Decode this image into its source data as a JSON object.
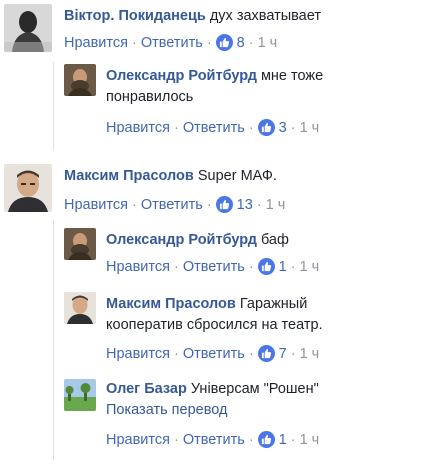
{
  "comments": [
    {
      "author": "Віктор. Покиданець",
      "text": "дух захватывает",
      "like": "Нравится",
      "reply": "Ответить",
      "likes": "8",
      "time": "1 ч"
    },
    {
      "author": "Олександр Ройтбурд",
      "text_line1": "мне тоже",
      "text_line2": "понравилось",
      "like": "Нравится",
      "reply": "Ответить",
      "likes": "3",
      "time": "1 ч"
    },
    {
      "author": "Максим Прасолов",
      "text": "Super МАФ.",
      "like": "Нравится",
      "reply": "Ответить",
      "likes": "13",
      "time": "1 ч"
    },
    {
      "author": "Олександр Ройтбурд",
      "text": "баф",
      "like": "Нравится",
      "reply": "Ответить",
      "likes": "1",
      "time": "1 ч"
    },
    {
      "author": "Максим Прасолов",
      "text_line1": "Гаражный",
      "text_line2": "кооператив сбросился на театр.",
      "like": "Нравится",
      "reply": "Ответить",
      "likes": "7",
      "time": "1 ч"
    },
    {
      "author": "Олег Базар",
      "text": "Універсам \"Рошен\"",
      "translate": "Показать перевод",
      "like": "Нравится",
      "reply": "Ответить",
      "likes": "1",
      "time": "1 ч"
    }
  ],
  "separator": "·",
  "colors": {
    "author": "#365899",
    "link": "#4267b2",
    "meta": "#90949c",
    "like_badge": "#4a76e8",
    "thread_line": "#dddfe2"
  },
  "icons": {
    "like": "thumbs-up-icon"
  }
}
